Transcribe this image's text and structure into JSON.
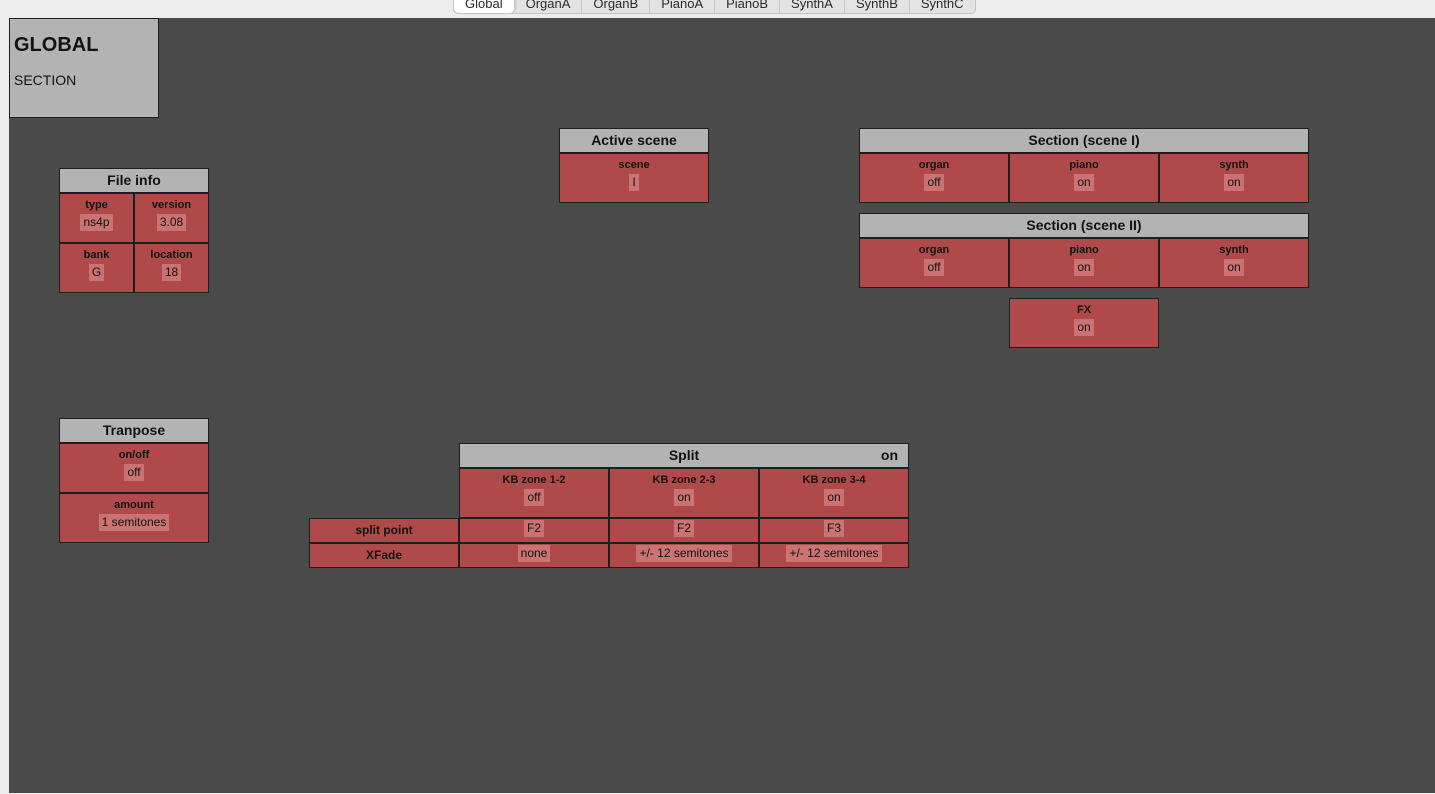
{
  "tabs": [
    "Global",
    "OrganA",
    "OrganB",
    "PianoA",
    "PianoB",
    "SynthA",
    "SynthB",
    "SynthC"
  ],
  "active_tab": "Global",
  "title": {
    "main": "GLOBAL",
    "sub": "SECTION"
  },
  "file_info": {
    "title": "File info",
    "type_label": "type",
    "type_value": "ns4p",
    "version_label": "version",
    "version_value": "3.08",
    "bank_label": "bank",
    "bank_value": "G",
    "location_label": "location",
    "location_value": "18"
  },
  "active_scene": {
    "title": "Active scene",
    "label": "scene",
    "value": "I"
  },
  "section_scene1": {
    "title": "Section (scene I)",
    "organ_label": "organ",
    "organ_value": "off",
    "piano_label": "piano",
    "piano_value": "on",
    "synth_label": "synth",
    "synth_value": "on"
  },
  "section_scene2": {
    "title": "Section (scene II)",
    "organ_label": "organ",
    "organ_value": "off",
    "piano_label": "piano",
    "piano_value": "on",
    "synth_label": "synth",
    "synth_value": "on"
  },
  "fx": {
    "label": "FX",
    "value": "on"
  },
  "transpose": {
    "title": "Tranpose",
    "onoff_label": "on/off",
    "onoff_value": "off",
    "amount_label": "amount",
    "amount_value": "1 semitones"
  },
  "split": {
    "title": "Split",
    "state": "on",
    "zones": [
      {
        "label": "KB zone 1-2",
        "value": "off",
        "split_point": "F2",
        "xfade": "none"
      },
      {
        "label": "KB zone 2-3",
        "value": "on",
        "split_point": "F2",
        "xfade": "+/- 12 semitones"
      },
      {
        "label": "KB zone 3-4",
        "value": "on",
        "split_point": "F3",
        "xfade": "+/- 12 semitones"
      }
    ],
    "split_point_label": "split point",
    "xfade_label": "XFade"
  },
  "colors": {
    "canvas_bg": "#4a4a4a",
    "panel_header": "#b3b3b3",
    "cell_bg": "#b04a4a",
    "value_bg": "#cb7272"
  }
}
